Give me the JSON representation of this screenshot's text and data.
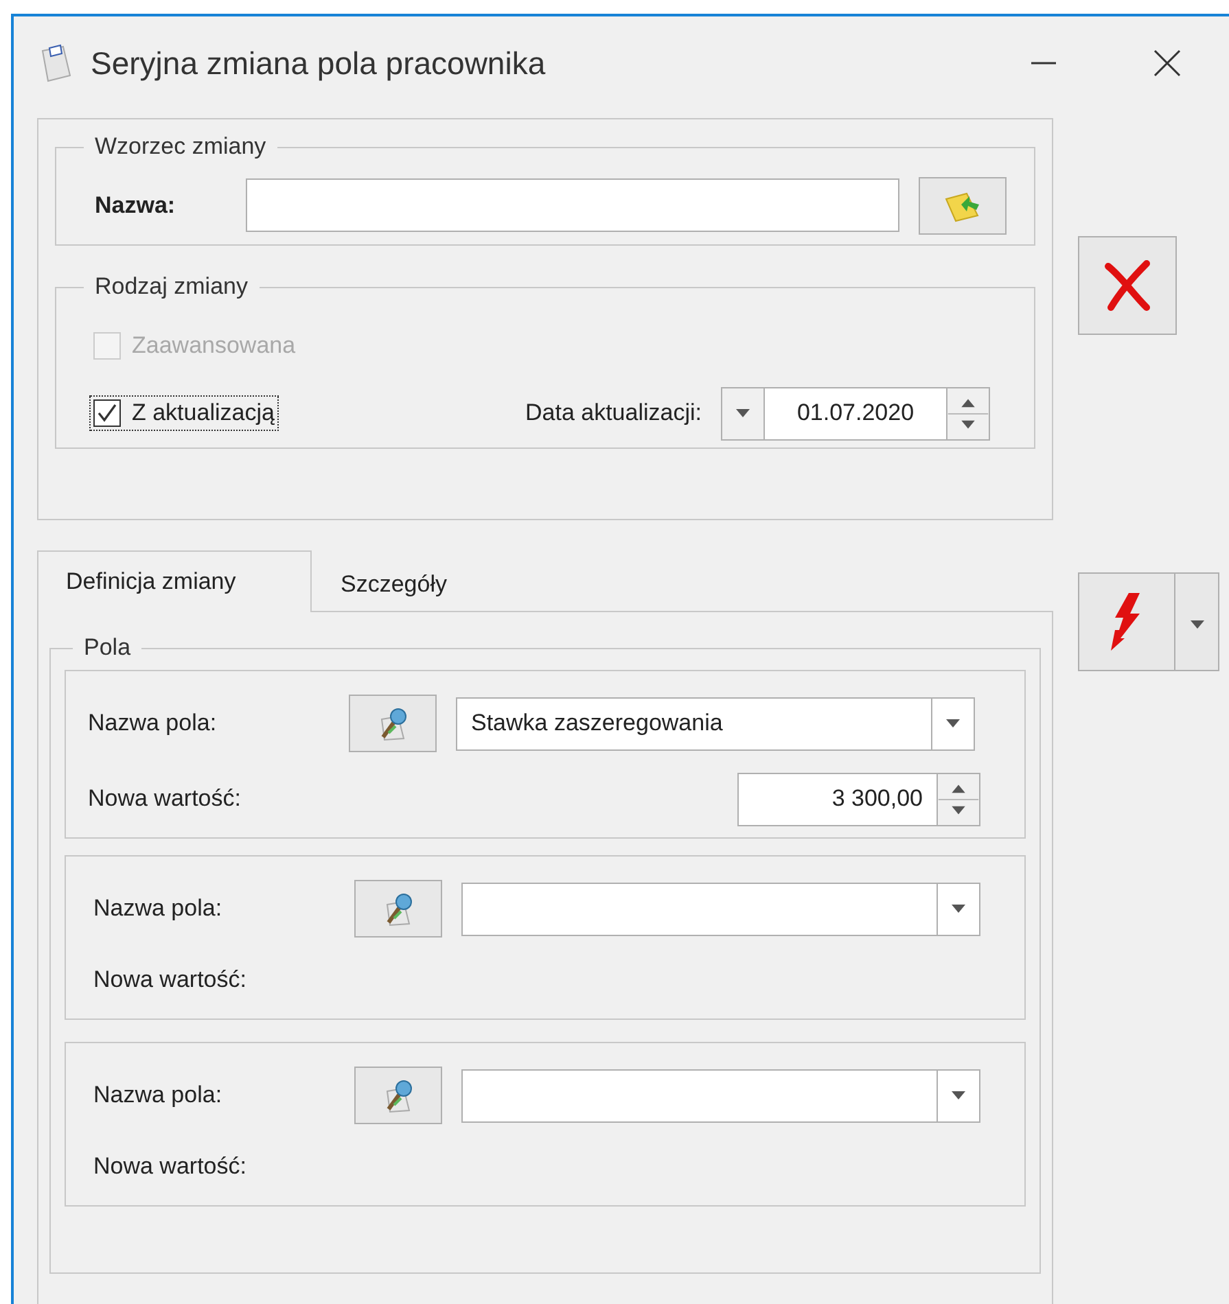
{
  "window": {
    "title": "Seryjna zmiana pola pracownika"
  },
  "template": {
    "title": "Wzorzec zmiany",
    "name_label": "Nazwa:"
  },
  "change_type": {
    "title": "Rodzaj zmiany",
    "checkboxes": [
      {
        "label": "Zaawansowana",
        "checked": false,
        "disabled": true,
        "focused": false
      },
      {
        "label": "Z aktualizacją",
        "checked": true,
        "disabled": false,
        "focused": true
      }
    ],
    "date_label": "Data aktualizacji:",
    "date_value": "01.07.2020"
  },
  "tabs": [
    {
      "label": "Definicja zmiany",
      "selected": true
    },
    {
      "label": "Szczegóły",
      "selected": false
    }
  ],
  "fields": {
    "title": "Pola",
    "rows": [
      {
        "name_label": "Nazwa pola:",
        "field": "Stawka zaszeregowania",
        "value_label": "Nowa wartość:",
        "new_value": "3 300,00"
      },
      {
        "name_label": "Nazwa pola:",
        "value_label": "Nowa wartość:"
      },
      {
        "name_label": "Nazwa pola:",
        "value_label": "Nowa wartość:"
      }
    ]
  }
}
